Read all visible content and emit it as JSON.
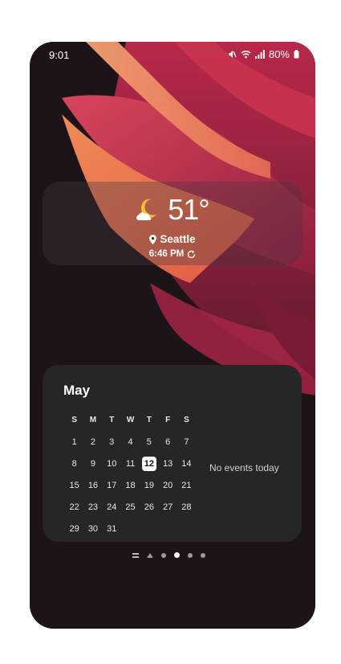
{
  "status_bar": {
    "time": "9:01",
    "battery": "80%",
    "icons": [
      "mute-icon",
      "wifi-icon",
      "signal-icon",
      "battery-icon"
    ]
  },
  "weather": {
    "temperature": "51°",
    "location": "Seattle",
    "updated_time": "6:46 PM",
    "icon": "moon-cloud-icon"
  },
  "calendar": {
    "month": "May",
    "weekdays": [
      "S",
      "M",
      "T",
      "W",
      "T",
      "F",
      "S"
    ],
    "weeks": [
      [
        "1",
        "2",
        "3",
        "4",
        "5",
        "6",
        "7"
      ],
      [
        "8",
        "9",
        "10",
        "11",
        "12",
        "13",
        "14"
      ],
      [
        "15",
        "16",
        "17",
        "18",
        "19",
        "20",
        "21"
      ],
      [
        "22",
        "23",
        "24",
        "25",
        "26",
        "27",
        "28"
      ],
      [
        "29",
        "30",
        "31",
        "",
        "",
        "",
        ""
      ]
    ],
    "today": "12",
    "no_events_text": "No events today"
  },
  "pager": {
    "page_count": 5,
    "active_page": 3
  },
  "colors": {
    "phone_bg": "#1d1419",
    "widget_bg": "#262626",
    "accent_weather": "#f6c12e"
  }
}
